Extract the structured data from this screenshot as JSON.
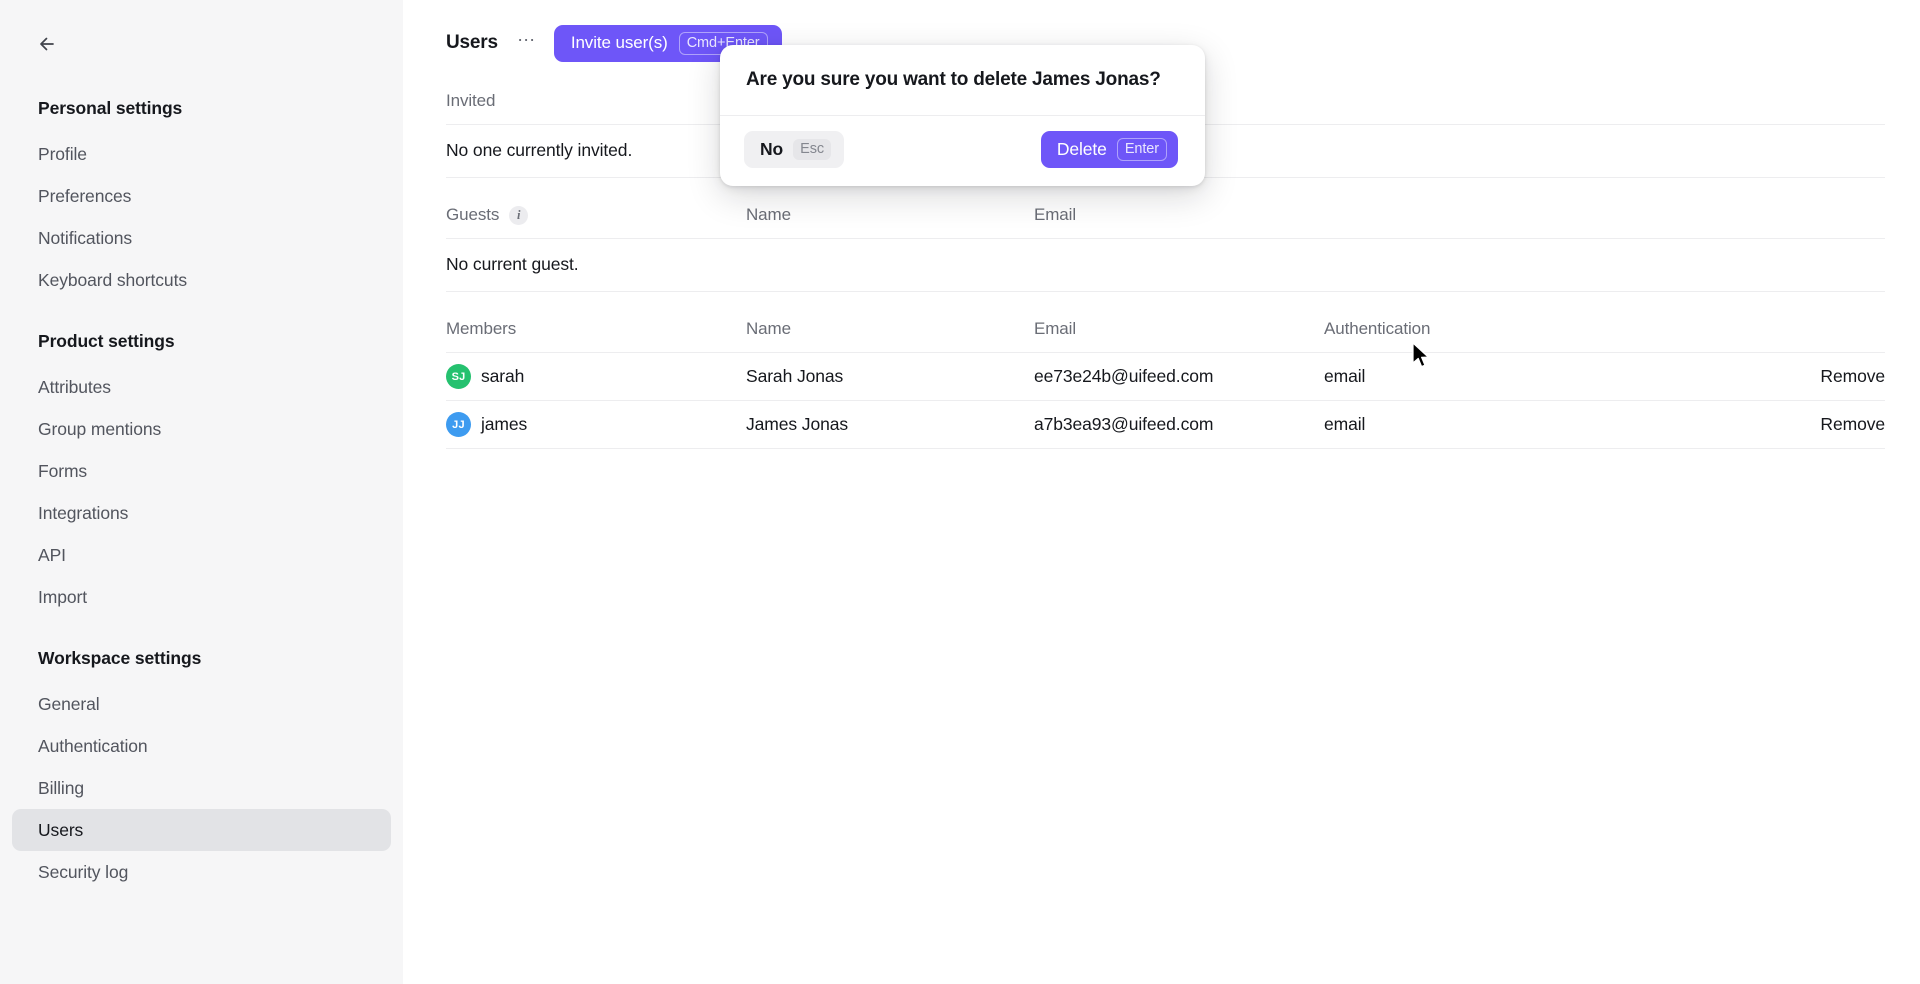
{
  "sidebar": {
    "back_icon": "arrow-left-icon",
    "groups": [
      {
        "title": "Personal settings",
        "items": [
          {
            "label": "Profile",
            "active": false
          },
          {
            "label": "Preferences",
            "active": false
          },
          {
            "label": "Notifications",
            "active": false
          },
          {
            "label": "Keyboard shortcuts",
            "active": false
          }
        ]
      },
      {
        "title": "Product settings",
        "items": [
          {
            "label": "Attributes",
            "active": false
          },
          {
            "label": "Group mentions",
            "active": false
          },
          {
            "label": "Forms",
            "active": false
          },
          {
            "label": "Integrations",
            "active": false
          },
          {
            "label": "API",
            "active": false
          },
          {
            "label": "Import",
            "active": false
          }
        ]
      },
      {
        "title": "Workspace settings",
        "items": [
          {
            "label": "General",
            "active": false
          },
          {
            "label": "Authentication",
            "active": false
          },
          {
            "label": "Billing",
            "active": false
          },
          {
            "label": "Users",
            "active": true
          },
          {
            "label": "Security log",
            "active": false
          }
        ]
      }
    ]
  },
  "header": {
    "title": "Users",
    "more_icon": "ellipsis-icon",
    "invite_label": "Invite user(s)",
    "invite_shortcut": "Cmd+Enter",
    "accent_color": "#6e56f8"
  },
  "invited": {
    "heading": "Invited",
    "empty_text": "No one currently invited."
  },
  "guests": {
    "heading": "Guests",
    "info_icon": "info-icon",
    "columns": {
      "name": "Name",
      "email": "Email"
    },
    "empty_text": "No current guest."
  },
  "members": {
    "heading": "Members",
    "columns": {
      "name": "Name",
      "email": "Email",
      "authentication": "Authentication"
    },
    "remove_label": "Remove",
    "rows": [
      {
        "initials": "SJ",
        "avatar_color": "#25c16f",
        "username": "sarah",
        "name": "Sarah Jonas",
        "email": "ee73e24b@uifeed.com",
        "authentication": "email",
        "remove": "Remove"
      },
      {
        "initials": "JJ",
        "avatar_color": "#3d9bf0",
        "username": "james",
        "name": "James Jonas",
        "email": "a7b3ea93@uifeed.com",
        "authentication": "email",
        "remove": "Remove"
      }
    ]
  },
  "dialog": {
    "message": "Are you sure you want to delete James Jonas?",
    "cancel_label": "No",
    "cancel_shortcut": "Esc",
    "confirm_label": "Delete",
    "confirm_shortcut": "Enter"
  }
}
